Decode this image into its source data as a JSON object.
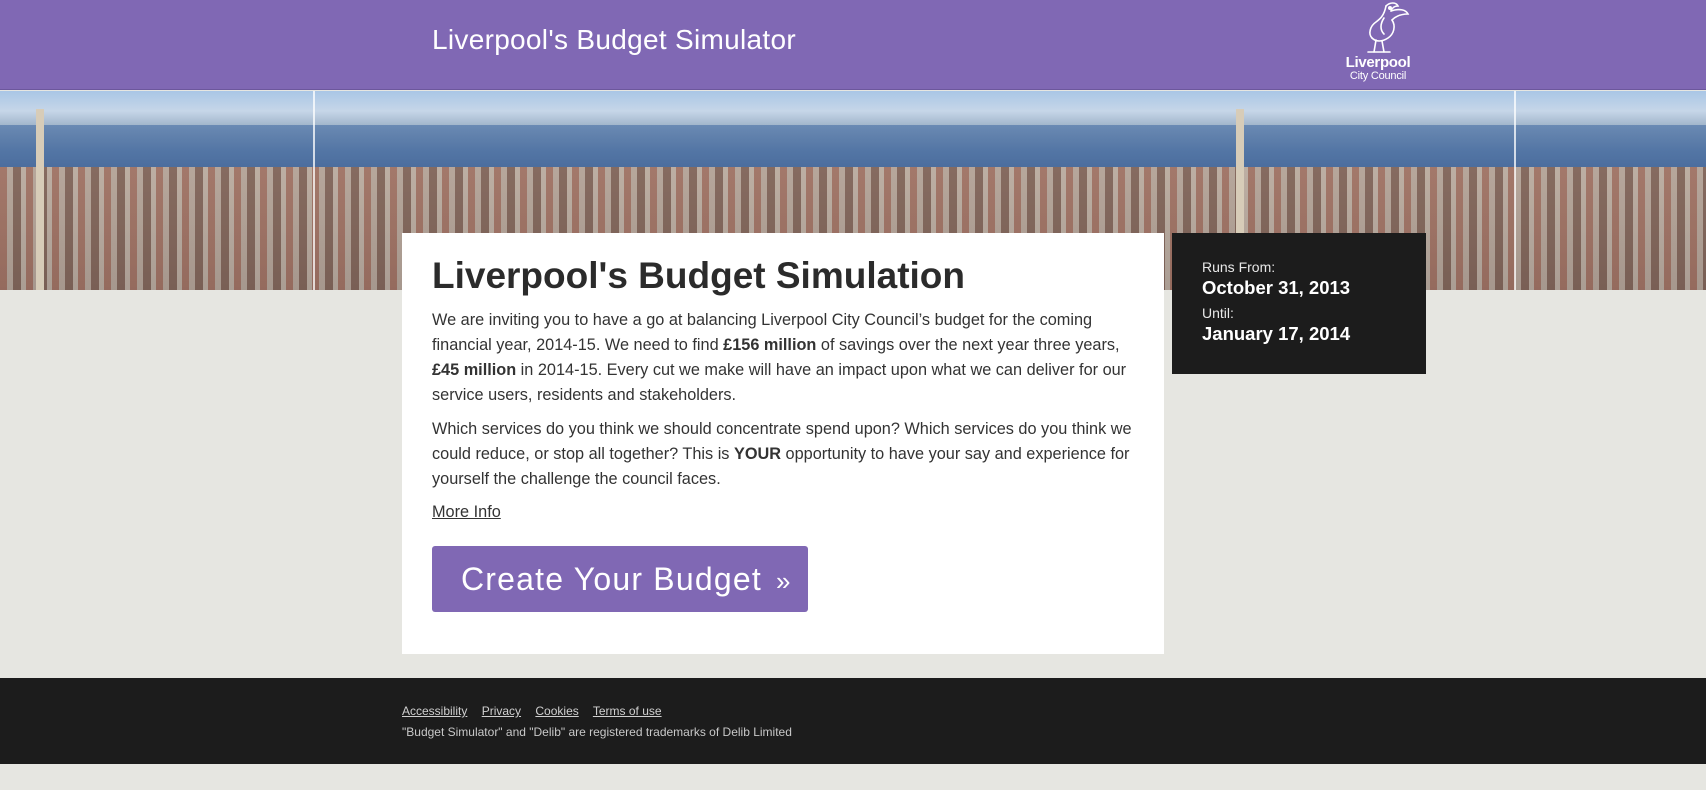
{
  "header": {
    "title": "Liverpool's Budget Simulator",
    "logo_line1": "Liverpool",
    "logo_line2": "City Council"
  },
  "main": {
    "title": "Liverpool's Budget Simulation",
    "p1_a": "We are inviting you to have a go at balancing Liverpool City Council’s budget for the coming financial year, 2014-15. We need to find ",
    "p1_b": "£156 million",
    "p1_c": " of savings over the next year three years, ",
    "p1_d": "£45 million",
    "p1_e": " in 2014-15. Every cut we make will have an impact upon what we can deliver for our service users, residents and stakeholders.",
    "p2_a": "Which services do you think we should concentrate spend upon? Which services do you think we could reduce, or stop all together? This is ",
    "p2_b": "YOUR",
    "p2_c": " opportunity to have your say and experience for yourself the challenge the council faces.",
    "more_info": "More Info",
    "cta_label": "Create Your Budget",
    "cta_chevron": "»"
  },
  "dates": {
    "from_label": "Runs From:",
    "from_value": "October 31, 2013",
    "until_label": "Until:",
    "until_value": "January 17, 2014"
  },
  "footer": {
    "links": [
      "Accessibility",
      "Privacy",
      "Cookies",
      "Terms of use"
    ],
    "note": "\"Budget Simulator\" and \"Delib\" are registered trademarks of Delib Limited"
  },
  "icons": {
    "logo": "liver-bird-icon"
  },
  "colors": {
    "brand": "#8068b4",
    "dark": "#1c1c1c",
    "page_bg": "#e6e6e1"
  }
}
